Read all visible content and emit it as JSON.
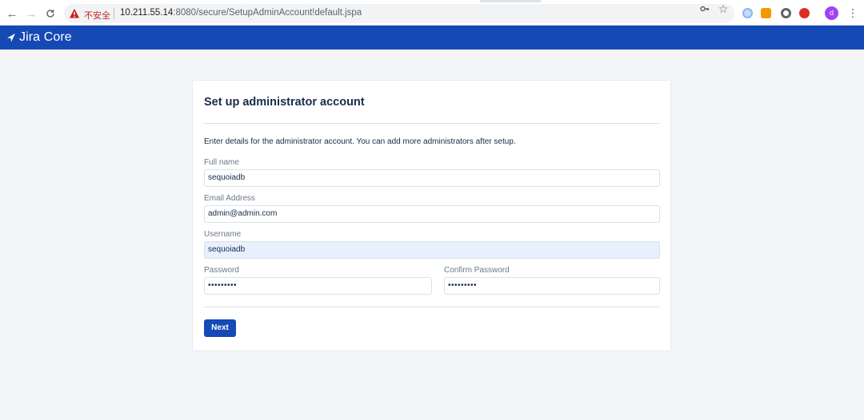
{
  "browser": {
    "nav": {
      "back": "←",
      "forward": "→",
      "reload": "C"
    },
    "security_label": "不安全",
    "url_host": "10.211.55.14",
    "url_path": ":8080/secure/SetupAdminAccount!default.jspa",
    "icons": [
      "key-icon",
      "star-icon",
      "extension-icon-1",
      "extension-icon-2",
      "extension-icon-3",
      "extension-icon-4"
    ],
    "profile_initial": "d"
  },
  "app": {
    "name": "Jira Core",
    "brand_color": "#1549b5"
  },
  "form": {
    "title": "Set up administrator account",
    "intro": "Enter details for the administrator account. You can add more administrators after setup.",
    "full_name": {
      "label": "Full name",
      "value": "sequoiadb"
    },
    "email": {
      "label": "Email Address",
      "value": "admin@admin.com"
    },
    "username": {
      "label": "Username",
      "value": "sequoiadb"
    },
    "password": {
      "label": "Password",
      "value": "•••••••••"
    },
    "confirm_password": {
      "label": "Confirm Password",
      "value": "•••••••••"
    },
    "next_label": "Next"
  }
}
